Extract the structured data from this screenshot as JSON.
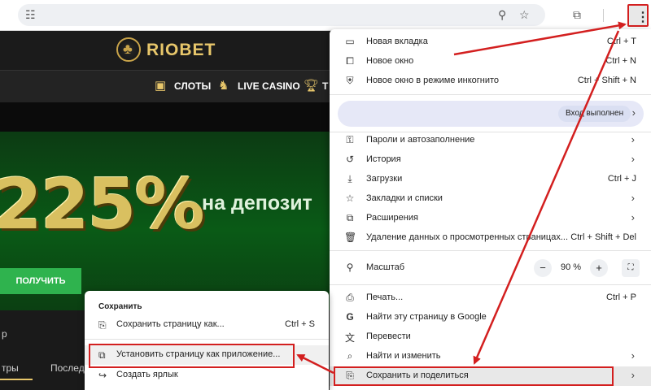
{
  "browser": {
    "menu_icon": "three-dots-vertical-icon"
  },
  "site": {
    "logo_text": "RIOBET",
    "nav": [
      {
        "label": "СЛОТЫ",
        "icon": "slots-icon"
      },
      {
        "label": "LIVE CASINO",
        "icon": "dealer-icon"
      },
      {
        "label": "Т",
        "icon": "trophy-icon"
      }
    ],
    "promo_big": "225%",
    "promo_sub": "на депозит",
    "cta_label": "ПОЛУЧИТЬ",
    "lower_text": "р",
    "lower_tab_1": "тры",
    "lower_tab_2": "Последн"
  },
  "chrome_menu": {
    "new_tab": {
      "label": "Новая вкладка",
      "shortcut": "Ctrl + T"
    },
    "new_window": {
      "label": "Новое окно",
      "shortcut": "Ctrl + N"
    },
    "incognito": {
      "label": "Новое окно в режиме инкогнито",
      "shortcut": "Ctrl + Shift + N"
    },
    "profile_status": "Вход выполнен",
    "passwords": {
      "label": "Пароли и автозаполнение"
    },
    "history": {
      "label": "История"
    },
    "downloads": {
      "label": "Загрузки",
      "shortcut": "Ctrl + J"
    },
    "bookmarks": {
      "label": "Закладки и списки"
    },
    "extensions": {
      "label": "Расширения"
    },
    "clear_data": {
      "label": "Удаление данных о просмотренных страницах...",
      "shortcut": "Ctrl + Shift + Del"
    },
    "zoom": {
      "label": "Масштаб",
      "minus": "−",
      "value": "90 %",
      "plus": "+"
    },
    "print": {
      "label": "Печать...",
      "shortcut": "Ctrl + P"
    },
    "google_search": {
      "label": "Найти эту страницу в Google"
    },
    "translate": {
      "label": "Перевести"
    },
    "find": {
      "label": "Найти и изменить"
    },
    "save_share": {
      "label": "Сохранить и поделиться"
    }
  },
  "save_submenu": {
    "header": "Сохранить",
    "save_page": {
      "label": "Сохранить страницу как...",
      "shortcut": "Ctrl + S"
    },
    "install_app": {
      "label": "Установить страницу как приложение..."
    },
    "create_shortcut": {
      "label": "Создать ярлык"
    }
  },
  "colors": {
    "annotation_red": "#d31f1f",
    "brand_gold": "#e8c76b",
    "cta_green": "#2fb34e"
  }
}
